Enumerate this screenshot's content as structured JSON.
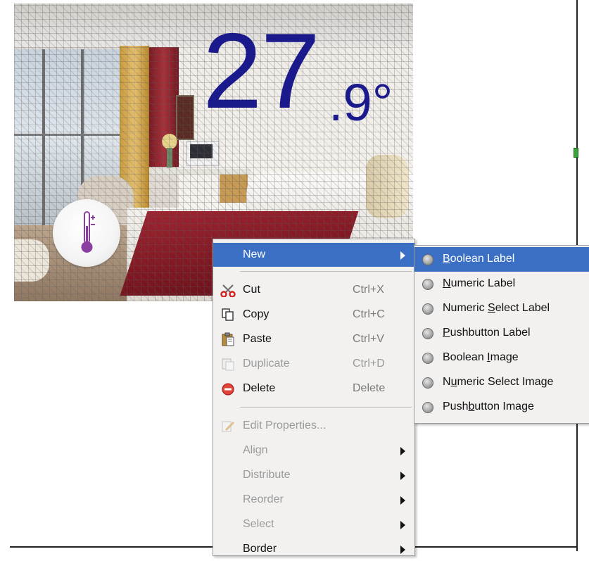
{
  "widget": {
    "temperature_int": "27",
    "temperature_dec": ".9°",
    "text_color": "#1a1a8c",
    "icon": "thermometer-icon"
  },
  "context_menu": {
    "items": [
      {
        "label": "New",
        "shortcut": "",
        "enabled": true,
        "submenu": true,
        "highlighted": true
      },
      {
        "label": "Cut",
        "shortcut": "Ctrl+X",
        "enabled": true,
        "icon": "scissors-icon"
      },
      {
        "label": "Copy",
        "shortcut": "Ctrl+C",
        "enabled": true,
        "icon": "copy-icon"
      },
      {
        "label": "Paste",
        "shortcut": "Ctrl+V",
        "enabled": true,
        "icon": "paste-icon"
      },
      {
        "label": "Duplicate",
        "shortcut": "Ctrl+D",
        "enabled": false,
        "icon": "duplicate-icon"
      },
      {
        "label": "Delete",
        "shortcut": "Delete",
        "enabled": true,
        "icon": "delete-icon"
      },
      {
        "label": "Edit Properties...",
        "shortcut": "",
        "enabled": false,
        "icon": "edit-properties-icon"
      },
      {
        "label": "Align",
        "shortcut": "",
        "enabled": false,
        "submenu": true
      },
      {
        "label": "Distribute",
        "shortcut": "",
        "enabled": false,
        "submenu": true
      },
      {
        "label": "Reorder",
        "shortcut": "",
        "enabled": false,
        "submenu": true
      },
      {
        "label": "Select",
        "shortcut": "",
        "enabled": false,
        "submenu": true
      },
      {
        "label": "Border",
        "shortcut": "",
        "enabled": true,
        "submenu": true
      }
    ]
  },
  "new_submenu": {
    "items": [
      {
        "pre": "",
        "mnemonic": "B",
        "post": "oolean Label",
        "highlighted": true
      },
      {
        "pre": "",
        "mnemonic": "N",
        "post": "umeric Label"
      },
      {
        "pre": "Numeric ",
        "mnemonic": "S",
        "post": "elect Label"
      },
      {
        "pre": "",
        "mnemonic": "P",
        "post": "ushbutton Label"
      },
      {
        "pre": "Boolean ",
        "mnemonic": "I",
        "post": "mage"
      },
      {
        "pre": "N",
        "mnemonic": "u",
        "post": "meric Select Image"
      },
      {
        "pre": "Push",
        "mnemonic": "b",
        "post": "utton Image"
      }
    ]
  },
  "colors": {
    "highlight": "#3a6fc4",
    "menu_bg": "#f2f1ef"
  }
}
